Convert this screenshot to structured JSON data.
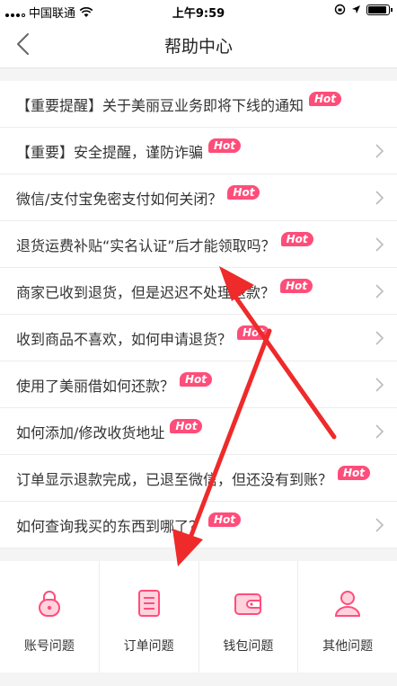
{
  "status_bar": {
    "carrier": "中国联通",
    "time": "上午9:59"
  },
  "nav": {
    "title": "帮助中心"
  },
  "faq": {
    "hot_label": "Hot",
    "items": [
      {
        "text": "【重要提醒】关于美丽豆业务即将下线的通知",
        "hot": true,
        "chevron": false
      },
      {
        "text": "【重要】安全提醒，谨防诈骗",
        "hot": true,
        "chevron": true
      },
      {
        "text": "微信/支付宝免密支付如何关闭？",
        "hot": true,
        "chevron": true
      },
      {
        "text": "退货运费补贴“实名认证”后才能领取吗？",
        "hot": true,
        "chevron": true
      },
      {
        "text": "商家已收到退货，但是迟迟不处理退款？",
        "hot": true,
        "chevron": true
      },
      {
        "text": "收到商品不喜欢，如何申请退货？",
        "hot": true,
        "chevron": true
      },
      {
        "text": "使用了美丽借如何还款？",
        "hot": true,
        "chevron": true
      },
      {
        "text": "如何添加/修改收货地址",
        "hot": true,
        "chevron": true
      },
      {
        "text": "订单显示退款完成，已退至微信，但还没有到账？",
        "hot": true,
        "chevron": false
      },
      {
        "text": "如何查询我买的东西到哪了？",
        "hot": true,
        "chevron": true
      }
    ]
  },
  "categories": [
    {
      "label": "账号问题",
      "icon": "lock-icon"
    },
    {
      "label": "订单问题",
      "icon": "order-list-icon"
    },
    {
      "label": "钱包问题",
      "icon": "wallet-icon"
    },
    {
      "label": "其他问题",
      "icon": "person-icon"
    }
  ],
  "colors": {
    "accent": "#ff4d7a",
    "annotation_arrow": "#ee2a2a"
  }
}
